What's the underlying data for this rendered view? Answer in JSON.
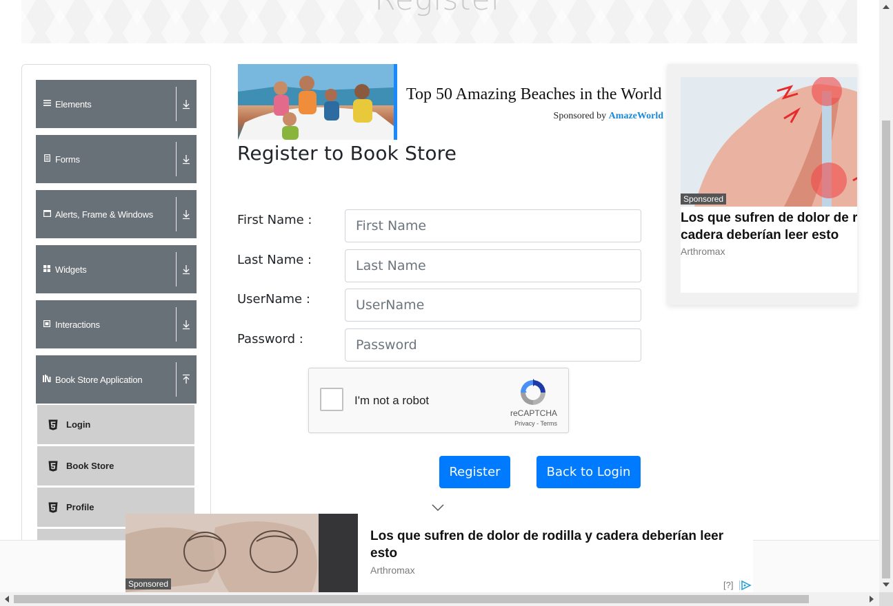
{
  "banner": {
    "title": "Register"
  },
  "sidebar": {
    "groups": [
      {
        "label": "Elements",
        "icon": "hamburger-icon",
        "state": "collapsed"
      },
      {
        "label": "Forms",
        "icon": "document-icon",
        "state": "collapsed"
      },
      {
        "label": "Alerts, Frame & Windows",
        "icon": "window-icon",
        "state": "collapsed"
      },
      {
        "label": "Widgets",
        "icon": "grid-icon",
        "state": "collapsed"
      },
      {
        "label": "Interactions",
        "icon": "cursor-box-icon",
        "state": "collapsed"
      },
      {
        "label": "Book Store Application",
        "icon": "books-icon",
        "state": "expanded"
      }
    ],
    "subitems": [
      {
        "label": "Login",
        "icon": "html5-icon"
      },
      {
        "label": "Book Store",
        "icon": "html5-icon"
      },
      {
        "label": "Profile",
        "icon": "html5-icon"
      }
    ]
  },
  "top_ad": {
    "title": "Top 50 Amazing Beaches in the World",
    "sponsored_prefix": "Sponsored by",
    "sponsor": "AmazeWorld"
  },
  "form": {
    "heading": "Register to Book Store",
    "fields": [
      {
        "label": "First Name :",
        "placeholder": "First Name",
        "value": ""
      },
      {
        "label": "Last Name :",
        "placeholder": "Last Name",
        "value": ""
      },
      {
        "label": "UserName :",
        "placeholder": "UserName",
        "value": ""
      },
      {
        "label": "Password :",
        "placeholder": "Password",
        "value": ""
      }
    ],
    "captcha": {
      "text": "I'm not a robot",
      "brand": "reCAPTCHA",
      "links": "Privacy - Terms"
    },
    "register_button": "Register",
    "back_button": "Back to Login"
  },
  "right_ad": {
    "badge": "Sponsored",
    "title_line1": "Los que sufren de dolor de rodilla y",
    "title_line2": "cadera deberían leer esto",
    "source": "Arthromax"
  },
  "bottom_ad": {
    "badge": "Sponsored",
    "title": "Los que sufren de dolor de rodilla y cadera deberían leer esto",
    "source": "Arthromax",
    "help": "[?]"
  },
  "colors": {
    "primary": "#007bff",
    "sidebar_group": "#687078",
    "sidebar_sub": "#cfcfcf"
  }
}
